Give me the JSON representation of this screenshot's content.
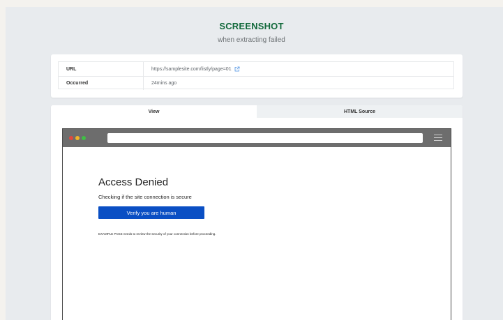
{
  "header": {
    "title": "SCREENSHOT",
    "subtitle": "when extracting failed"
  },
  "info": {
    "rows": [
      {
        "key": "URL",
        "value": "https://samplesite.com/listly/page=01"
      },
      {
        "key": "Occurred",
        "value": "24mins ago"
      }
    ],
    "link_icon": "external-link-icon"
  },
  "tabs": [
    {
      "label": "View",
      "active": true
    },
    {
      "label": "HTML Source",
      "active": false
    }
  ],
  "browser": {
    "window_controls": [
      "close",
      "minimize",
      "maximize"
    ],
    "menu_icon": "hamburger-menu-icon",
    "page": {
      "heading": "Access Denied",
      "check_text": "Checking if the site connection is secure",
      "button_label": "Verify you are human",
      "note": "EXAMPLE PAGE needs to review the security of your connection before proceeding."
    }
  },
  "colors": {
    "title": "#136a3c",
    "button": "#0a4fc4",
    "link_icon": "#4a90e2",
    "dot_red": "#e0483e",
    "dot_yellow": "#f0b429",
    "dot_green": "#3fbf45"
  }
}
